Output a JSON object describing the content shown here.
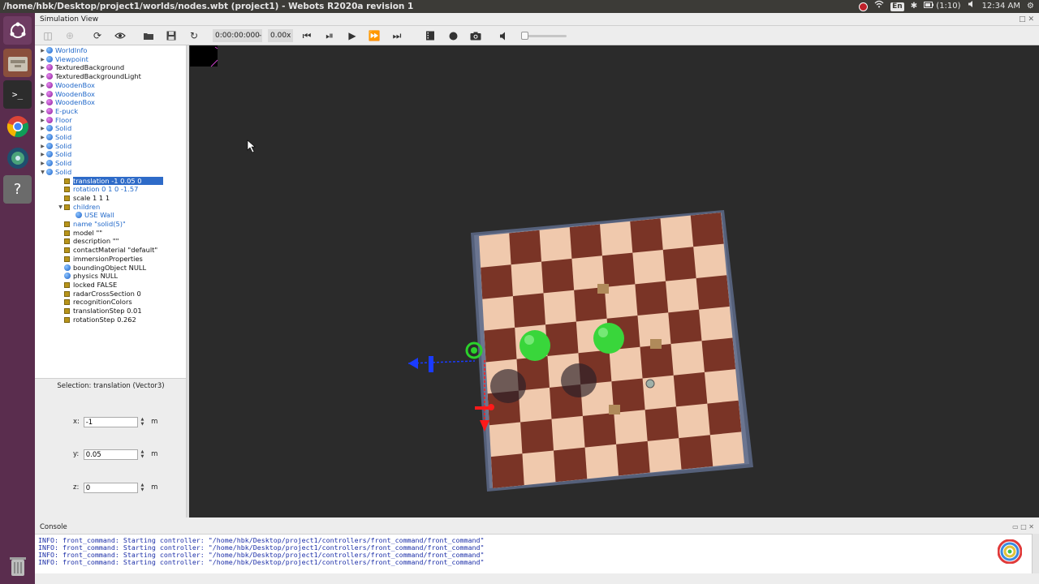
{
  "window": {
    "title": "/home/hbk/Desktop/project1/worlds/nodes.wbt (project1) - Webots R2020a revision 1",
    "panel_title": "Simulation View"
  },
  "tray": {
    "keyboard_layout": "En",
    "battery": "(1:10)",
    "clock": "12:34 AM"
  },
  "toolbar": {
    "time": "0:00:00:000",
    "separator": "-",
    "speed": "0.00x"
  },
  "scene_tree": {
    "rows": [
      {
        "label": "WorldInfo",
        "kind": "node",
        "dot": "blue"
      },
      {
        "label": "Viewpoint",
        "kind": "node",
        "dot": "blue"
      },
      {
        "label": "TexturedBackground",
        "kind": "node",
        "dot": "purple",
        "dark": true
      },
      {
        "label": "TexturedBackgroundLight",
        "kind": "node",
        "dot": "purple",
        "dark": true
      },
      {
        "label": "WoodenBox",
        "kind": "node",
        "dot": "purple"
      },
      {
        "label": "WoodenBox",
        "kind": "node",
        "dot": "purple"
      },
      {
        "label": "WoodenBox",
        "kind": "node",
        "dot": "purple"
      },
      {
        "label": "E-puck",
        "kind": "node",
        "dot": "purple"
      },
      {
        "label": "Floor",
        "kind": "node",
        "dot": "purple"
      },
      {
        "label": "Solid",
        "kind": "node",
        "dot": "blue"
      },
      {
        "label": "Solid",
        "kind": "node",
        "dot": "blue"
      },
      {
        "label": "Solid",
        "kind": "node",
        "dot": "blue"
      },
      {
        "label": "Solid",
        "kind": "node",
        "dot": "blue"
      },
      {
        "label": "Solid",
        "kind": "node",
        "dot": "blue"
      },
      {
        "label": "Solid",
        "kind": "node",
        "dot": "blue",
        "expanded": true
      },
      {
        "label": "translation -1 0.05 0",
        "kind": "field",
        "selected": true
      },
      {
        "label": "rotation 0 1 0 -1.57",
        "kind": "field"
      },
      {
        "label": "scale 1 1 1",
        "kind": "field",
        "dark": true
      },
      {
        "label": "children",
        "kind": "field",
        "expanded": true
      },
      {
        "label": "USE Wall",
        "kind": "node",
        "dot": "blue",
        "child": true
      },
      {
        "label": "name \"solid(5)\"",
        "kind": "field"
      },
      {
        "label": "model \"\"",
        "kind": "field",
        "dark": true
      },
      {
        "label": "description \"\"",
        "kind": "field",
        "dark": true
      },
      {
        "label": "contactMaterial \"default\"",
        "kind": "field",
        "dark": true
      },
      {
        "label": "immersionProperties",
        "kind": "field",
        "dark": true
      },
      {
        "label": "boundingObject NULL",
        "kind": "node",
        "dot": "blue",
        "dark": true
      },
      {
        "label": "physics NULL",
        "kind": "node",
        "dot": "blue",
        "dark": true
      },
      {
        "label": "locked FALSE",
        "kind": "field",
        "dark": true
      },
      {
        "label": "radarCrossSection 0",
        "kind": "field",
        "dark": true
      },
      {
        "label": "recognitionColors",
        "kind": "field",
        "dark": true
      },
      {
        "label": "translationStep 0.01",
        "kind": "field",
        "dark": true
      },
      {
        "label": "rotationStep 0.262",
        "kind": "field",
        "dark": true
      }
    ]
  },
  "field_editor": {
    "selection_title": "Selection: translation (Vector3)",
    "x_label": "x:",
    "x_value": "-1",
    "y_label": "y:",
    "y_value": "0.05",
    "z_label": "z:",
    "z_value": "0",
    "unit": "m"
  },
  "console": {
    "title": "Console",
    "lines": [
      "INFO: front_command: Starting controller: \"/home/hbk/Desktop/project1/controllers/front_command/front_command\"",
      "INFO: front_command: Starting controller: \"/home/hbk/Desktop/project1/controllers/front_command/front_command\"",
      "INFO: front_command: Starting controller: \"/home/hbk/Desktop/project1/controllers/front_command/front_command\"",
      "INFO: front_command: Starting controller: \"/home/hbk/Desktop/project1/controllers/front_command/front_command\""
    ]
  },
  "colors": {
    "launcher": "#5a2d4e",
    "selection": "#2e6bc8",
    "console_text": "#1c2fa8",
    "viewport_bg": "#2b2b2b"
  }
}
